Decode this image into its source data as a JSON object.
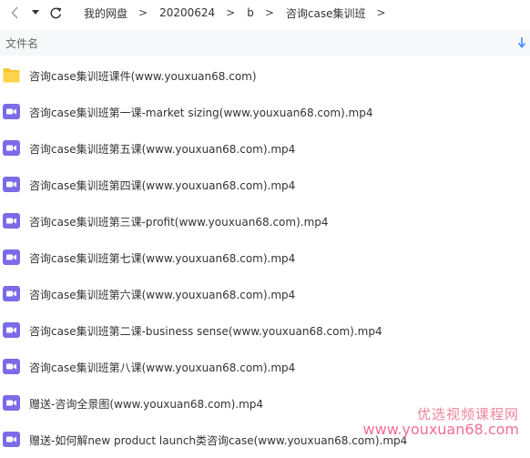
{
  "navigation": {
    "back_icon": "chevron-left-icon",
    "dropdown_icon": "caret-down-icon",
    "refresh_icon": "refresh-icon",
    "breadcrumbs": [
      "我的网盘",
      "20200624",
      "b",
      "咨询case集训班"
    ],
    "separator": ">"
  },
  "header": {
    "column_label": "文件名",
    "sort_icon": "sort-down-arrow-icon",
    "accent_color": "#3b8cff"
  },
  "files": [
    {
      "name": "咨询case集训班课件(www.youxuan68.com)",
      "type": "folder"
    },
    {
      "name": "咨询case集训班第一课-market sizing(www.youxuan68.com).mp4",
      "type": "video"
    },
    {
      "name": "咨询case集训班第五课(www.youxuan68.com).mp4",
      "type": "video"
    },
    {
      "name": "咨询case集训班第四课(www.youxuan68.com).mp4",
      "type": "video"
    },
    {
      "name": "咨询case集训班第三课-profit(www.youxuan68.com).mp4",
      "type": "video"
    },
    {
      "name": "咨询case集训班第七课(www.youxuan68.com).mp4",
      "type": "video"
    },
    {
      "name": "咨询case集训班第六课(www.youxuan68.com).mp4",
      "type": "video"
    },
    {
      "name": "咨询case集训班第二课-business sense(www.youxuan68.com).mp4",
      "type": "video"
    },
    {
      "name": "咨询case集训班第八课(www.youxuan68.com).mp4",
      "type": "video"
    },
    {
      "name": "赠送-咨询全景图(www.youxuan68.com).mp4",
      "type": "video"
    },
    {
      "name": "赠送-如何解new product launch类咨询case(www.youxuan68.com).mp4",
      "type": "video"
    }
  ],
  "colors": {
    "folder": "#f9c532",
    "video": "#7b6be8"
  },
  "watermark": {
    "line1": "优选视频课程网",
    "line2": "www.youxuan68.com"
  }
}
